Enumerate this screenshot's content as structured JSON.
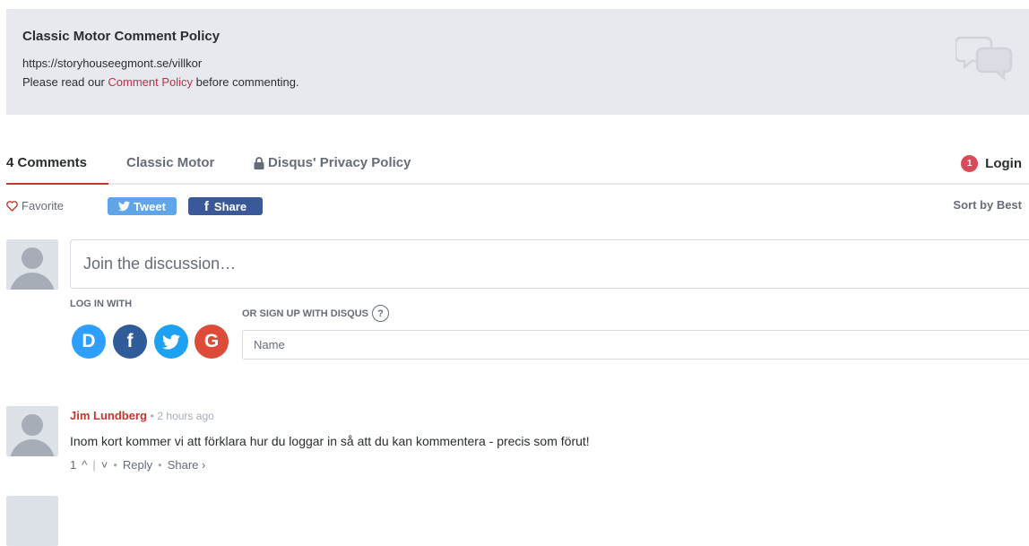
{
  "policy": {
    "title": "Classic Motor Comment Policy",
    "url": "https://storyhouseegmont.se/villkor",
    "text_before": "Please read our ",
    "link": "Comment Policy",
    "text_after": " before commenting."
  },
  "tabs": {
    "count": "4 Comments",
    "forum": "Classic Motor",
    "privacy": "Disqus' Privacy Policy",
    "login": "Login",
    "login_badge": "1"
  },
  "actions": {
    "favorite": "Favorite",
    "tweet": "Tweet",
    "share": "Share",
    "sort": "Sort by Best"
  },
  "compose": {
    "placeholder": "Join the discussion…",
    "login_with": "LOG IN WITH",
    "signup": "OR SIGN UP WITH DISQUS",
    "help": "?",
    "name_placeholder": "Name",
    "social": {
      "disqus": "D",
      "facebook": "f",
      "google": "G"
    }
  },
  "comments": [
    {
      "author": "Jim Lundberg",
      "sep": "•",
      "time": "2 hours ago",
      "body": "Inom kort kommer vi att förklara hur du loggar in så att du kan kommentera - precis som förut!",
      "votes": "1",
      "up": "^",
      "bar": "|",
      "down": "˅",
      "dot": "•",
      "reply": "Reply",
      "share": "Share ›"
    }
  ],
  "colors": {
    "accent": "#c0392b",
    "link": "#b8324a",
    "policy_bg": "#e7e9ee",
    "tweet": "#5fa5e8",
    "facebook": "#3b5998"
  }
}
